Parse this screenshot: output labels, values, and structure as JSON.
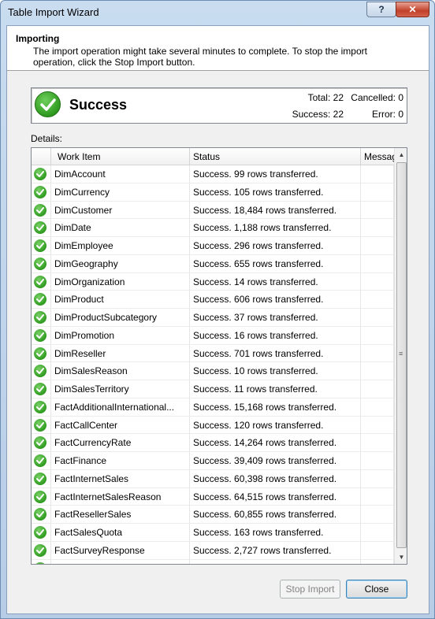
{
  "window": {
    "title": "Table Import Wizard",
    "help_label": "?",
    "close_label": "✕"
  },
  "header": {
    "title": "Importing",
    "description": "The import operation might take several minutes to complete. To stop the import operation, click the Stop Import button."
  },
  "summary": {
    "status": "Success",
    "total": "Total: 22",
    "cancelled": "Cancelled: 0",
    "success": "Success: 22",
    "error": "Error: 0"
  },
  "details": {
    "label": "Details:",
    "columns": {
      "work_item": "Work Item",
      "status": "Status",
      "message": "Message"
    },
    "rows": [
      {
        "item": "DimAccount",
        "status": "Success. 99 rows transferred."
      },
      {
        "item": "DimCurrency",
        "status": "Success. 105 rows transferred."
      },
      {
        "item": "DimCustomer",
        "status": "Success. 18,484 rows transferred."
      },
      {
        "item": "DimDate",
        "status": "Success. 1,188 rows transferred."
      },
      {
        "item": "DimEmployee",
        "status": "Success. 296 rows transferred."
      },
      {
        "item": "DimGeography",
        "status": "Success. 655 rows transferred."
      },
      {
        "item": "DimOrganization",
        "status": "Success. 14 rows transferred."
      },
      {
        "item": "DimProduct",
        "status": "Success. 606 rows transferred."
      },
      {
        "item": "DimProductSubcategory",
        "status": "Success. 37 rows transferred."
      },
      {
        "item": "DimPromotion",
        "status": "Success. 16 rows transferred."
      },
      {
        "item": "DimReseller",
        "status": "Success. 701 rows transferred."
      },
      {
        "item": "DimSalesReason",
        "status": "Success. 10 rows transferred."
      },
      {
        "item": "DimSalesTerritory",
        "status": "Success. 11 rows transferred."
      },
      {
        "item": "FactAdditionalInternational...",
        "status": "Success. 15,168 rows transferred."
      },
      {
        "item": "FactCallCenter",
        "status": "Success. 120 rows transferred."
      },
      {
        "item": "FactCurrencyRate",
        "status": "Success. 14,264 rows transferred."
      },
      {
        "item": "FactFinance",
        "status": "Success. 39,409 rows transferred."
      },
      {
        "item": "FactInternetSales",
        "status": "Success. 60,398 rows transferred."
      },
      {
        "item": "FactInternetSalesReason",
        "status": "Success. 64,515 rows transferred."
      },
      {
        "item": "FactResellerSales",
        "status": "Success. 60,855 rows transferred."
      },
      {
        "item": "FactSalesQuota",
        "status": "Success. 163 rows transferred."
      },
      {
        "item": "FactSurveyResponse",
        "status": "Success. 2,727 rows transferred."
      },
      {
        "item": "",
        "status": ""
      }
    ]
  },
  "buttons": {
    "stop_import": "Stop Import",
    "close": "Close"
  },
  "icons": {
    "status_icon": "success-check-icon",
    "row_icon": "success-check-icon"
  },
  "colors": {
    "success_green": "#2e9a1e",
    "title_bar": "#c9dcf0",
    "close_button_red": "#c1412a"
  }
}
